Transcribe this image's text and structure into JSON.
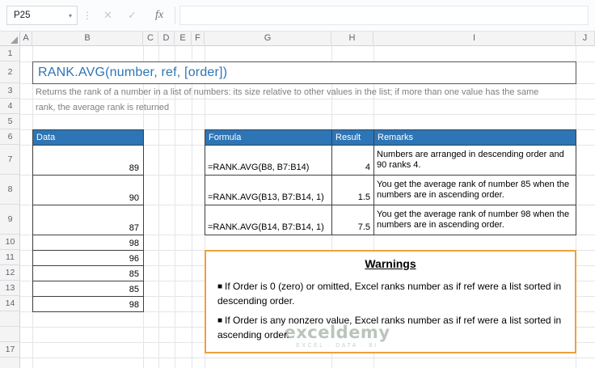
{
  "window": {
    "name_box": "P25"
  },
  "formula_bar": {
    "handle": "⋮",
    "dropdown": "▾",
    "cancel": "✕",
    "enter": "✓",
    "fx": "fx"
  },
  "grid": {
    "columns": [
      "A",
      "B",
      "C",
      "D",
      "E",
      "F",
      "G",
      "H",
      "I",
      "J"
    ],
    "rows": [
      "1",
      "2",
      "3",
      "4",
      "5",
      "6",
      "7",
      "8",
      "9",
      "10",
      "11",
      "12",
      "13",
      "14",
      "",
      "",
      "17"
    ]
  },
  "title": "RANK.AVG(number, ref, [order])",
  "description": "Returns the rank of a number in a list of numbers: its size relative to other values in the list; if more than one value has the same rank, the average rank is returned",
  "data_table": {
    "header": "Data",
    "values": [
      89,
      90,
      87,
      98,
      96,
      85,
      85,
      98
    ]
  },
  "formula_table": {
    "headers": {
      "formula": "Formula",
      "result": "Result",
      "remarks": "Remarks"
    },
    "rows": [
      {
        "formula": "=RANK.AVG(B8, B7:B14)",
        "result": "4",
        "remark": "Numbers are arranged in descending order and 90 ranks 4."
      },
      {
        "formula": "=RANK.AVG(B13, B7:B14, 1)",
        "result": "1.5",
        "remark": "You get the average rank of number 85 when the numbers are in ascending order."
      },
      {
        "formula": "=RANK.AVG(B14, B7:B14, 1)",
        "result": "7.5",
        "remark": "You get the average rank of number 98 when the numbers are in ascending order."
      }
    ]
  },
  "warnings": {
    "title": "Warnings",
    "bullet": "■",
    "items": [
      "If Order is 0 (zero) or omitted, Excel ranks number as if ref were a list sorted in descending order.",
      "If Order is any nonzero value, Excel ranks number as if ref were a list sorted in ascending order."
    ]
  },
  "watermark": {
    "logo": "exceldemy",
    "tagline": "EXCEL · DATA · BI"
  },
  "colors": {
    "table_header_bg": "#2E75B6",
    "title_text": "#2E75B6",
    "description_text": "#7F7F7F",
    "warning_border": "#EDA13C",
    "cell_border": "#3F3F3F"
  }
}
